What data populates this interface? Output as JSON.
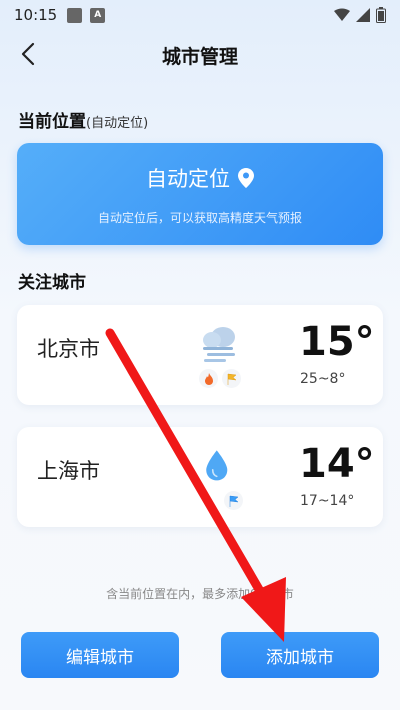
{
  "status_bar": {
    "time": "10:15",
    "notif_letter": "A"
  },
  "header": {
    "title": "城市管理"
  },
  "current_location": {
    "section_title": "当前位置",
    "section_title_note": "(自动定位)",
    "button_label": "自动定位",
    "subtitle": "自动定位后，可以获取高精度天气预报"
  },
  "followed": {
    "section_title": "关注城市",
    "cities": [
      {
        "name": "北京市",
        "weather_icon": "cloud-fog-icon",
        "temp": "15°",
        "range": "25~8°"
      },
      {
        "name": "上海市",
        "weather_icon": "raindrop-icon",
        "temp": "14°",
        "range": "17~14°"
      }
    ]
  },
  "note": "含当前位置在内，最多添加9个城市",
  "buttons": {
    "edit": "编辑城市",
    "add": "添加城市"
  },
  "colors": {
    "accent": "#2f8cf5",
    "arrow": "#f01818"
  }
}
